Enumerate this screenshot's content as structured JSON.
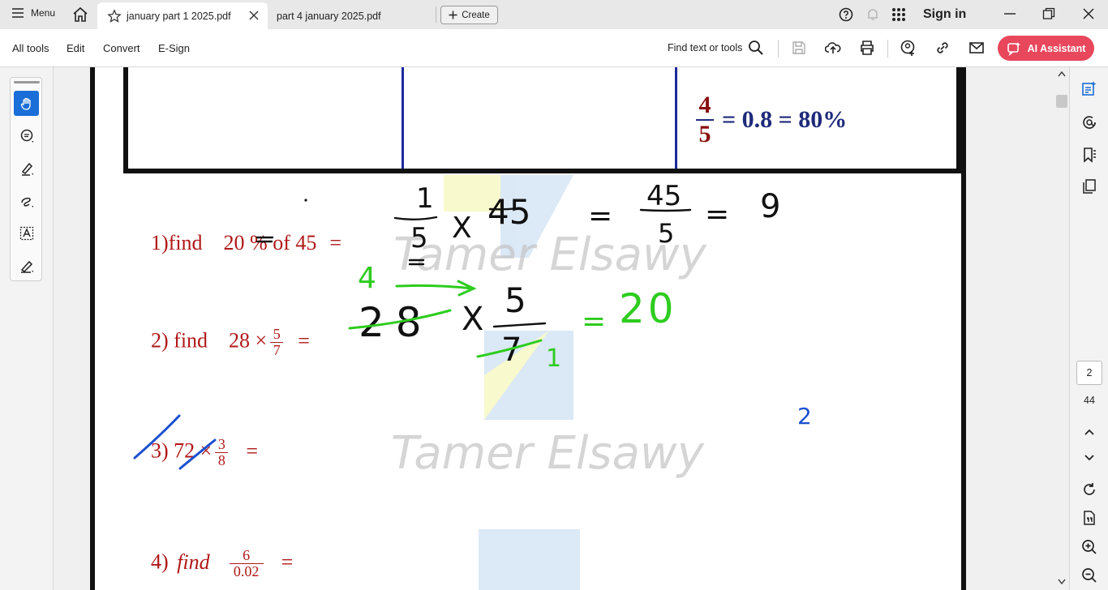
{
  "titlebar": {
    "menu_label": "Menu",
    "tabs": [
      {
        "label": "january part 1  2025.pdf",
        "active": true
      },
      {
        "label": "part 4 january 2025.pdf",
        "active": false
      }
    ],
    "create_label": "Create",
    "sign_in_label": "Sign in"
  },
  "toolbar": {
    "menu_items": [
      "All tools",
      "Edit",
      "Convert",
      "E-Sign"
    ],
    "find_label": "Find text or tools",
    "ai_label": "AI Assistant"
  },
  "document": {
    "table_fraction": {
      "num": "4",
      "den": "5",
      "rest": "= 0.8 = 80%"
    },
    "problems": {
      "p1": {
        "text": "1)find    20 % of 45",
        "eq": "="
      },
      "p2": {
        "prefix": "2) find    28 ×",
        "num": "5",
        "den": "7",
        "eq": "="
      },
      "p3": {
        "prefix": "3) 72 ×",
        "num": "3",
        "den": "8",
        "eq": "="
      },
      "p4": {
        "prefix": "4) ",
        "italic": "find",
        "num": "6",
        "den": "0.02",
        "eq": "="
      }
    },
    "handwriting": {
      "p1": {
        "num": "1",
        "den": "5",
        "x1": "X",
        "n45": "45",
        "eq1": "=",
        "fnum": "45",
        "fden": "5",
        "eq2": "=",
        "result": "9"
      },
      "p2": {
        "four": "4",
        "n28": "28",
        "x": "X",
        "num": "5",
        "den": "7",
        "one": "1",
        "eq": "=",
        "result": "20"
      },
      "p3_mark": "2"
    },
    "watermark": "Tamer Elsawy"
  },
  "pagenav": {
    "current_page": "2",
    "total_pages": "44"
  }
}
